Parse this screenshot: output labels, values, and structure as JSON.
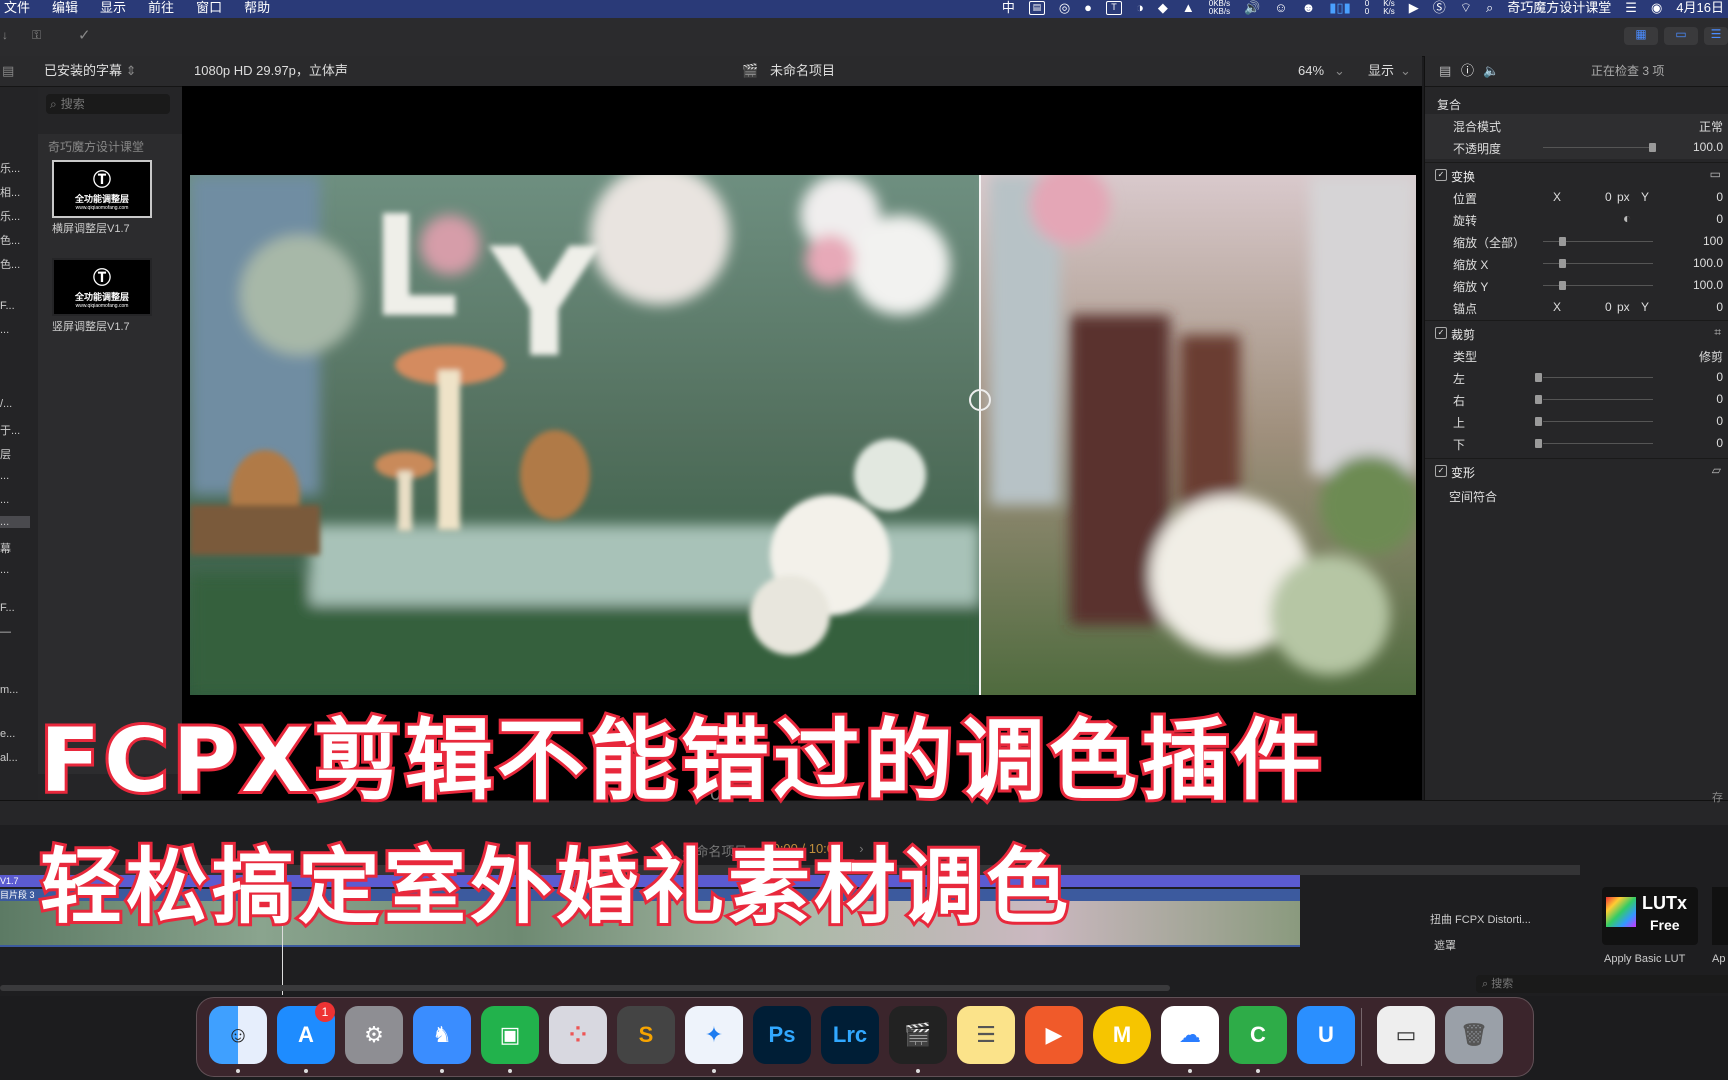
{
  "menubar": {
    "items": [
      "文件",
      "编辑",
      "显示",
      "前往",
      "窗口",
      "帮助"
    ],
    "right_text": "奇巧魔方设计课堂",
    "date": "4月16日",
    "net_up": "0KB/s",
    "net_down": "0KB/s",
    "ks_top": "K/s",
    "ks_bottom": "K/s",
    "zero_top": "0",
    "zero_bottom": "0",
    "input": "中"
  },
  "browser": {
    "title": "已安装的字幕",
    "search_placeholder": "搜索",
    "group": "奇巧魔方设计课堂",
    "items": [
      {
        "thumb_title": "全功能调整层",
        "thumb_sub": "www.qiqiaomofang.com",
        "label": "横屏调整层V1.7"
      },
      {
        "thumb_title": "全功能调整层",
        "thumb_sub": "www.qiqiaomofang.com",
        "label": "竖屏调整层V1.7"
      }
    ]
  },
  "left_strip": [
    "乐...",
    "相...",
    "乐...",
    "色...",
    "色...",
    "F...",
    "...",
    "/...",
    "于...",
    "层",
    "...",
    "...",
    "...",
    "幕",
    "...",
    "F...",
    "—",
    "m...",
    "e...",
    "al..."
  ],
  "viewer": {
    "format": "1080p HD 29.97p，立体声",
    "project": "未命名项目",
    "zoom": "64%",
    "display": "显示"
  },
  "inspector": {
    "title": "正在检查 3 项",
    "composite": "复合",
    "blend_label": "混合模式",
    "blend_value": "正常",
    "opacity_label": "不透明度",
    "opacity_value": "100.0",
    "transform": "变换",
    "position": "位置",
    "x": "X",
    "y": "Y",
    "px": "px",
    "pos_x": "0",
    "pos_y": "0",
    "rotation": "旋转",
    "rotation_value": "0",
    "scale_all": "缩放（全部）",
    "scale_all_value": "100",
    "scale_x": "缩放 X",
    "scale_x_value": "100.0",
    "scale_y": "缩放 Y",
    "scale_y_value": "100.0",
    "anchor": "锚点",
    "anchor_x": "0",
    "anchor_y": "0",
    "crop": "裁剪",
    "type_label": "类型",
    "type_value": "修剪",
    "left": "左",
    "right": "右",
    "top": "上",
    "bottom": "下",
    "crop_value": "0",
    "distort": "变形",
    "spatial": "空间符合"
  },
  "timeline": {
    "project": "未命名项目",
    "time": "10:00 / 10:00",
    "track_label": "V1.7",
    "clip_label": "目片段 3",
    "play_time": "00",
    "effect_item": "扭曲 FCPX Distorti...",
    "mask": "遮罩",
    "effects_search": "搜索",
    "lut_title": "LUTx",
    "lut_sub": "Free",
    "lut_label": "Apply Basic LUT",
    "lut2_label": "Ap",
    "save": "存"
  },
  "captions": {
    "line1": "FCPX剪辑不能错过的调色插件",
    "line2": "轻松搞定室外婚礼素材调色"
  },
  "dock": {
    "badge": "1",
    "items": [
      "finder-icon",
      "app-store-icon",
      "system-preferences-icon",
      "qq-icon",
      "wechat-icon",
      "launchpad-icon",
      "sublime-icon",
      "safari-icon",
      "photoshop-icon",
      "lightroom-icon",
      "final-cut-icon",
      "notes-icon",
      "infuse-icon",
      "miaoyan-icon",
      "baidu-netdisk-icon",
      "camtasia-icon",
      "uu-icon",
      "screenshot-icon",
      "trash-icon"
    ],
    "ps": "Ps",
    "lrc": "Lrc",
    "m": "M"
  }
}
